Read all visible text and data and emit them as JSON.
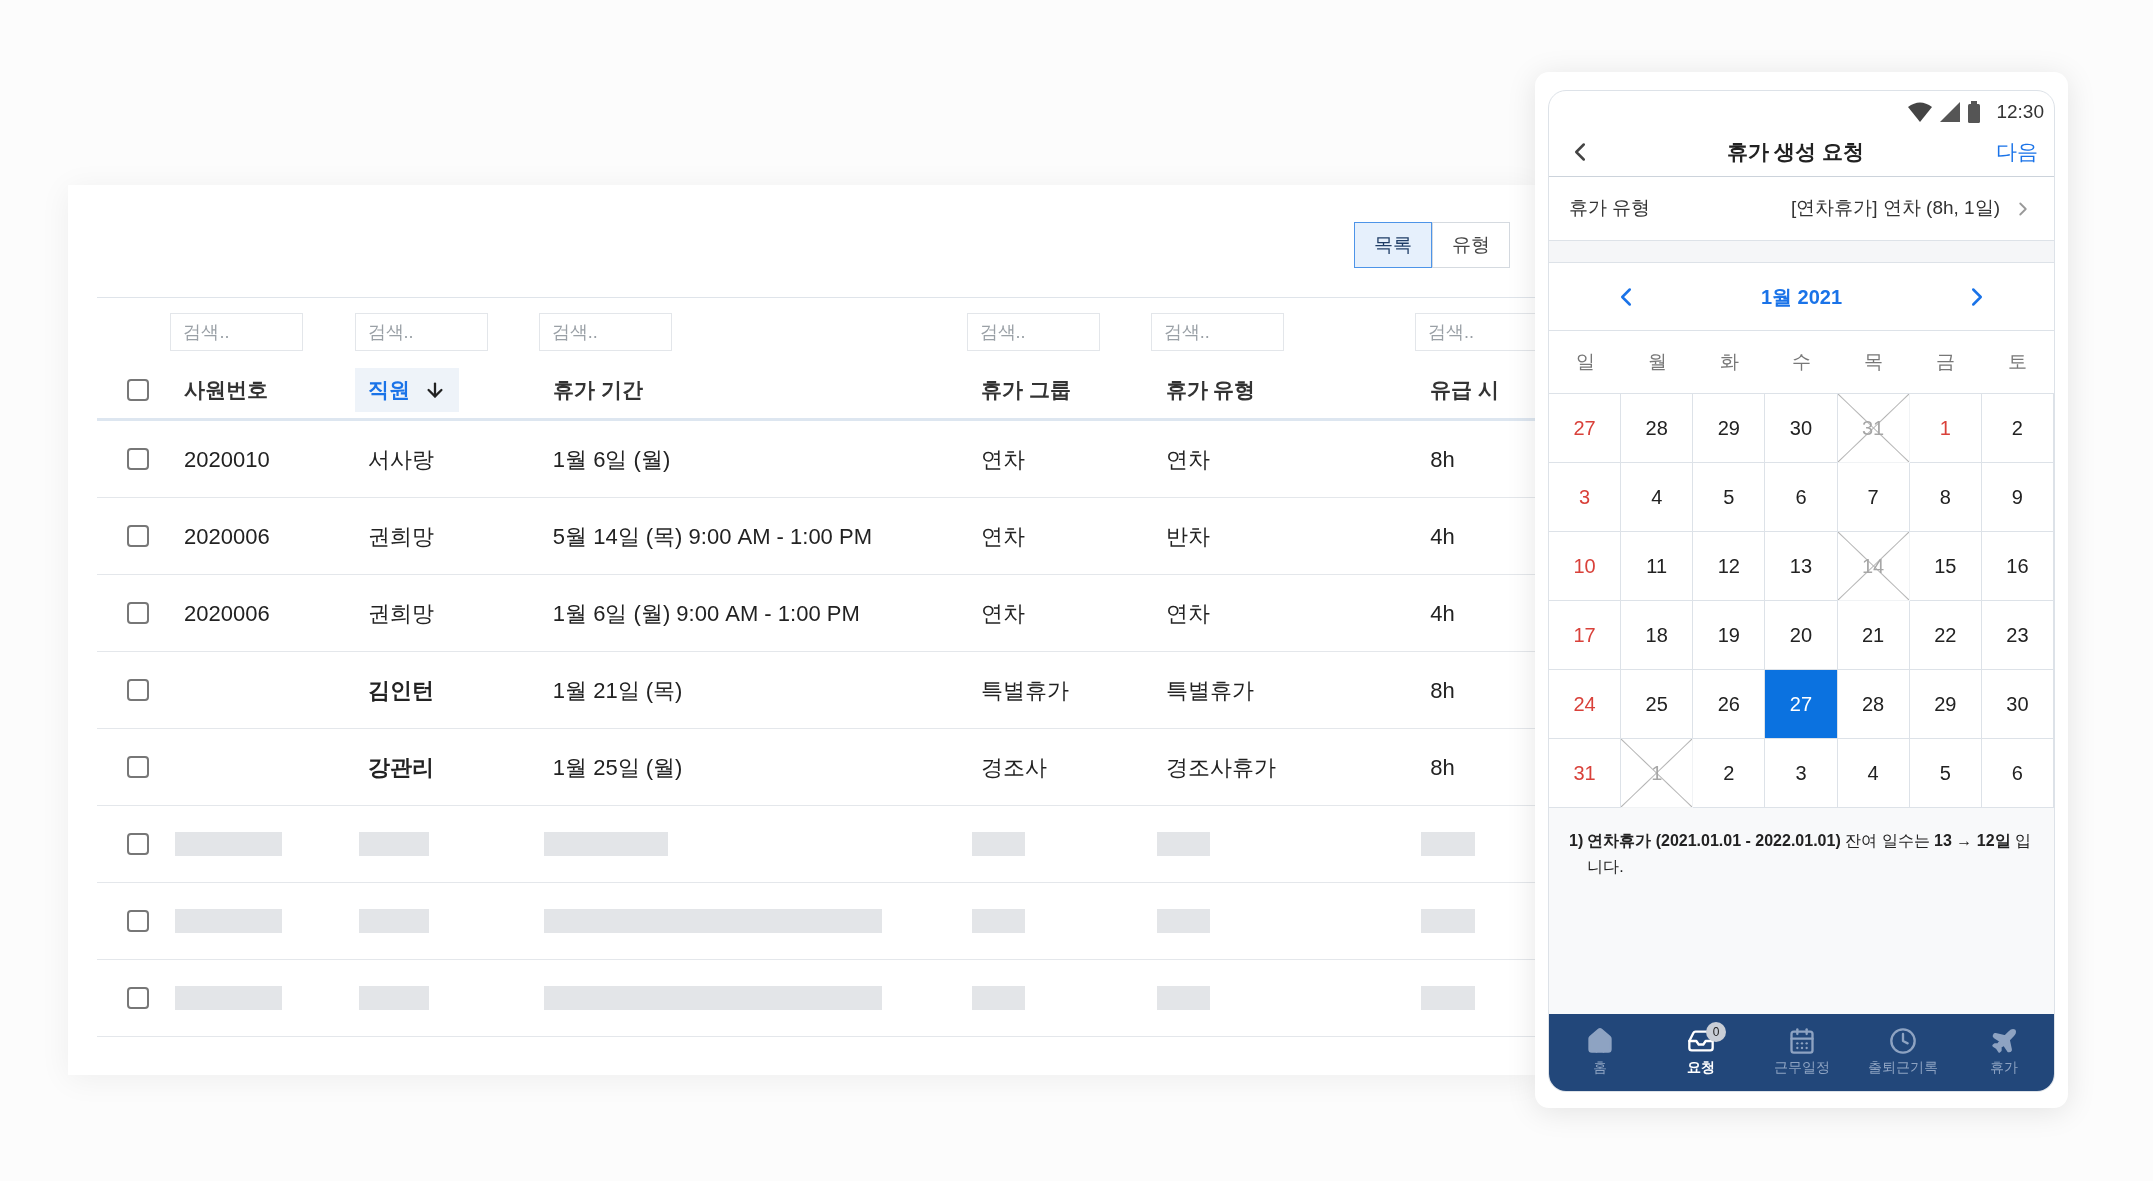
{
  "table": {
    "views": [
      {
        "label": "목록",
        "selected": true
      },
      {
        "label": "유형",
        "selected": false
      }
    ],
    "select_all": {
      "checked": false
    },
    "columns": [
      {
        "label": "사원번호",
        "placeholder": "검색..",
        "selected": false
      },
      {
        "label": "직원",
        "placeholder": "검색..",
        "selected": true
      },
      {
        "label": "휴가 기간",
        "placeholder": "검색..",
        "selected": false
      },
      {
        "label": "휴가 그룹",
        "placeholder": "검색..",
        "selected": false
      },
      {
        "label": "휴가 유형",
        "placeholder": "검색..",
        "selected": false
      },
      {
        "label": "유급 시",
        "placeholder": "검색..",
        "selected": false
      }
    ],
    "rows": [
      {
        "kind": "data",
        "checked": false,
        "bold": false,
        "cells": [
          "2020010",
          "서사랑",
          "1월 6일 (월)",
          "연차",
          "연차",
          "8h"
        ]
      },
      {
        "kind": "data",
        "checked": false,
        "bold": false,
        "cells": [
          "2020006",
          "권희망",
          "5월 14일 (목) 9:00 AM - 1:00 PM",
          "연차",
          "반차",
          "4h"
        ]
      },
      {
        "kind": "data",
        "checked": false,
        "bold": false,
        "cells": [
          "2020006",
          "권희망",
          "1월 6일 (월) 9:00 AM - 1:00 PM",
          "연차",
          "연차",
          "4h"
        ]
      },
      {
        "kind": "data",
        "checked": false,
        "bold": true,
        "cells": [
          "",
          "김인턴",
          "1월 21일 (목)",
          "특별휴가",
          "특별휴가",
          "8h"
        ]
      },
      {
        "kind": "data",
        "checked": false,
        "bold": true,
        "cells": [
          "",
          "강관리",
          "1월 25일 (월)",
          "경조사",
          "경조사휴가",
          "8h"
        ]
      },
      {
        "kind": "short",
        "checked": false
      },
      {
        "kind": "long",
        "checked": false
      },
      {
        "kind": "long",
        "checked": false
      }
    ]
  },
  "phone": {
    "time": "12:30",
    "title": "휴가 생성 요청",
    "next": "다음",
    "leave_type": {
      "label": "휴가 유형",
      "value": "[연차휴가] 연차 (8h, 1일)"
    },
    "month": "1월 2021",
    "weekdays": [
      "일",
      "월",
      "화",
      "수",
      "목",
      "금",
      "토"
    ],
    "days": [
      {
        "label": "27",
        "holiday": true,
        "unavailable": false,
        "selected": false
      },
      {
        "label": "28",
        "holiday": false,
        "unavailable": false,
        "selected": false
      },
      {
        "label": "29",
        "holiday": false,
        "unavailable": false,
        "selected": false
      },
      {
        "label": "30",
        "holiday": false,
        "unavailable": false,
        "selected": false
      },
      {
        "label": "31",
        "holiday": false,
        "unavailable": true,
        "selected": false
      },
      {
        "label": "1",
        "holiday": true,
        "unavailable": false,
        "selected": false
      },
      {
        "label": "2",
        "holiday": false,
        "unavailable": false,
        "selected": false
      },
      {
        "label": "3",
        "holiday": true,
        "unavailable": false,
        "selected": false
      },
      {
        "label": "4",
        "holiday": false,
        "unavailable": false,
        "selected": false
      },
      {
        "label": "5",
        "holiday": false,
        "unavailable": false,
        "selected": false
      },
      {
        "label": "6",
        "holiday": false,
        "unavailable": false,
        "selected": false
      },
      {
        "label": "7",
        "holiday": false,
        "unavailable": false,
        "selected": false
      },
      {
        "label": "8",
        "holiday": false,
        "unavailable": false,
        "selected": false
      },
      {
        "label": "9",
        "holiday": false,
        "unavailable": false,
        "selected": false
      },
      {
        "label": "10",
        "holiday": true,
        "unavailable": false,
        "selected": false
      },
      {
        "label": "11",
        "holiday": false,
        "unavailable": false,
        "selected": false
      },
      {
        "label": "12",
        "holiday": false,
        "unavailable": false,
        "selected": false
      },
      {
        "label": "13",
        "holiday": false,
        "unavailable": false,
        "selected": false
      },
      {
        "label": "14",
        "holiday": false,
        "unavailable": true,
        "selected": false
      },
      {
        "label": "15",
        "holiday": false,
        "unavailable": false,
        "selected": false
      },
      {
        "label": "16",
        "holiday": false,
        "unavailable": false,
        "selected": false
      },
      {
        "label": "17",
        "holiday": true,
        "unavailable": false,
        "selected": false
      },
      {
        "label": "18",
        "holiday": false,
        "unavailable": false,
        "selected": false
      },
      {
        "label": "19",
        "holiday": false,
        "unavailable": false,
        "selected": false
      },
      {
        "label": "20",
        "holiday": false,
        "unavailable": false,
        "selected": false
      },
      {
        "label": "21",
        "holiday": false,
        "unavailable": false,
        "selected": false
      },
      {
        "label": "22",
        "holiday": false,
        "unavailable": false,
        "selected": false
      },
      {
        "label": "23",
        "holiday": false,
        "unavailable": false,
        "selected": false
      },
      {
        "label": "24",
        "holiday": true,
        "unavailable": false,
        "selected": false
      },
      {
        "label": "25",
        "holiday": false,
        "unavailable": false,
        "selected": false
      },
      {
        "label": "26",
        "holiday": false,
        "unavailable": false,
        "selected": false
      },
      {
        "label": "27",
        "holiday": false,
        "unavailable": false,
        "selected": true
      },
      {
        "label": "28",
        "holiday": false,
        "unavailable": false,
        "selected": false
      },
      {
        "label": "29",
        "holiday": false,
        "unavailable": false,
        "selected": false
      },
      {
        "label": "30",
        "holiday": false,
        "unavailable": false,
        "selected": false
      },
      {
        "label": "31",
        "holiday": true,
        "unavailable": false,
        "selected": false
      },
      {
        "label": "1",
        "holiday": false,
        "unavailable": true,
        "selected": false
      },
      {
        "label": "2",
        "holiday": false,
        "unavailable": false,
        "selected": false
      },
      {
        "label": "3",
        "holiday": false,
        "unavailable": false,
        "selected": false
      },
      {
        "label": "4",
        "holiday": false,
        "unavailable": false,
        "selected": false
      },
      {
        "label": "5",
        "holiday": false,
        "unavailable": false,
        "selected": false
      },
      {
        "label": "6",
        "holiday": false,
        "unavailable": false,
        "selected": false
      }
    ],
    "note_number": "1)",
    "note": "**연차휴가 (2021.01.01 - 2022.01.01)** 잔여 일수는 **13 → 12일** 입니다.",
    "nav": [
      {
        "kind": "home",
        "label": "홈",
        "selected": false
      },
      {
        "kind": "inbox",
        "label": "요청",
        "selected": true,
        "badge": "0"
      },
      {
        "kind": "calendar",
        "label": "근무일정",
        "selected": false
      },
      {
        "kind": "clock",
        "label": "출퇴근기록",
        "selected": false
      },
      {
        "kind": "plane",
        "label": "휴가",
        "selected": false
      }
    ]
  }
}
